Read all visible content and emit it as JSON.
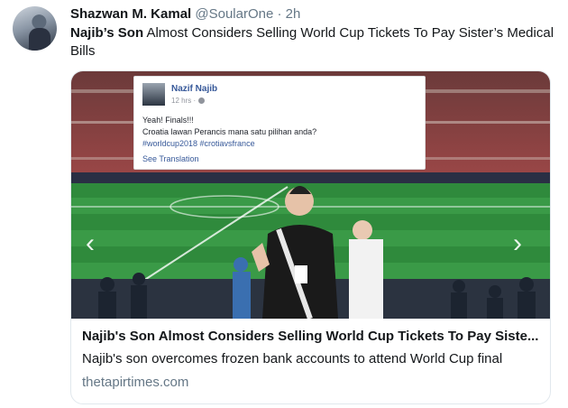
{
  "tweet": {
    "author_name": "Shazwan M. Kamal",
    "handle": "@SoularOne",
    "separator": "·",
    "time": "2h",
    "text_bold": "Najib’s Son",
    "text_rest": " Almost Considers Selling World Cup Tickets To Pay Sister’s Medical Bills"
  },
  "card": {
    "title": "Najib's Son Almost Considers Selling World Cup Tickets To Pay Siste...",
    "description": "Najib's son overcomes frozen bank accounts to attend World Cup final",
    "domain": "thetapirtimes.com"
  },
  "fb_post": {
    "name": "Nazif Najib",
    "time": "12 hrs ·",
    "line1": "Yeah! Finals!!!",
    "line2": "Croatia lawan Perancis mana satu pilihan anda?",
    "tags": "#worldcup2018 #crotiavsfrance",
    "translate": "See Translation"
  },
  "icons": {
    "prev": "chevron-left-icon",
    "next": "chevron-right-icon",
    "globe": "globe-icon"
  },
  "colors": {
    "link": "#365899",
    "muted": "#657786",
    "pitch": "#2f8a3c"
  }
}
